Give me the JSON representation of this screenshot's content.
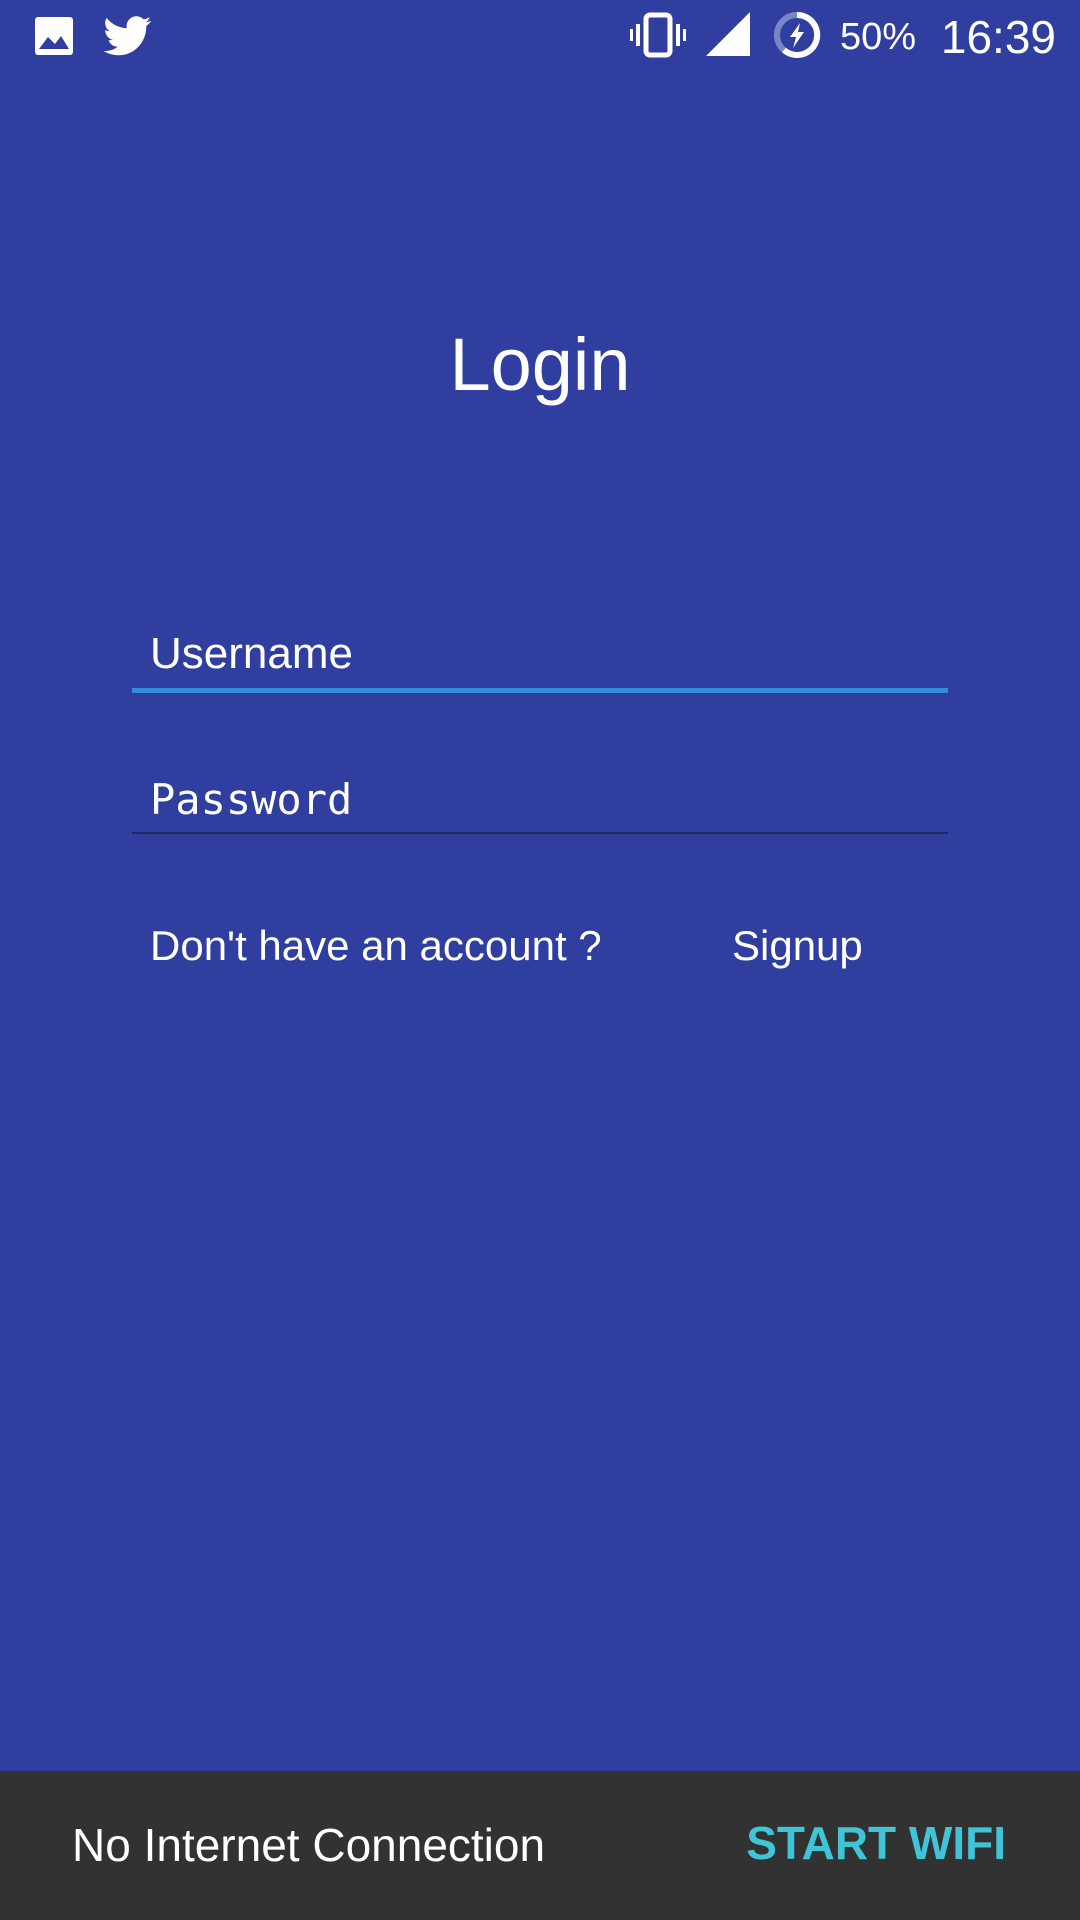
{
  "status_bar": {
    "icons": [
      "image-icon",
      "twitter-icon",
      "vibrate-icon",
      "signal-icon",
      "battery-saver-icon"
    ],
    "battery_percent": "50%",
    "time": "16:39"
  },
  "login": {
    "title": "Login",
    "username_placeholder": "Username",
    "password_placeholder": "Password",
    "account_prompt": "Don't have an account ?",
    "signup_label": "Signup"
  },
  "snackbar": {
    "message": "No Internet Connection",
    "action_label": "START WIFI"
  },
  "colors": {
    "background": "#303f9f",
    "field_focus_underline": "#2f8fdc",
    "field_underline": "#1f2a5e",
    "snackbar_background": "#323232",
    "snackbar_action": "#40c4d8"
  }
}
